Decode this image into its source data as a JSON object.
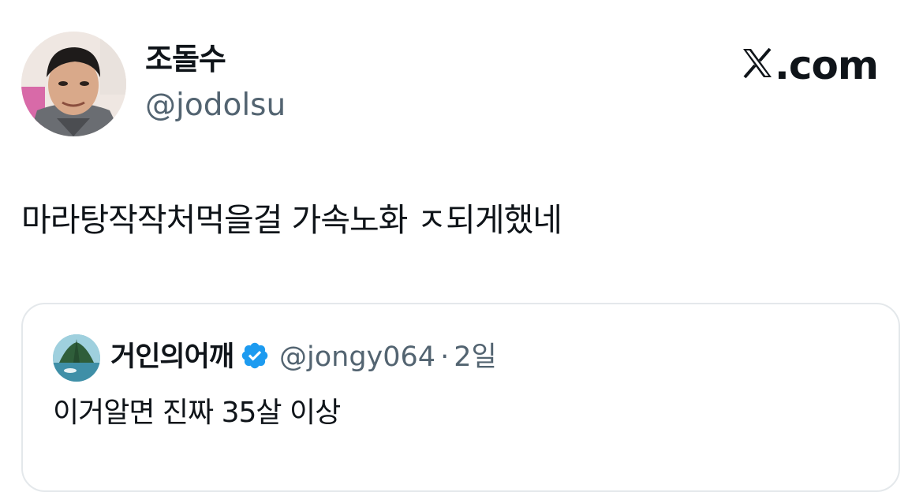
{
  "author": {
    "display_name": "조돌수",
    "handle": "@jodolsu",
    "avatar_icon": "profile-photo"
  },
  "brand": {
    "text": ".com",
    "logo_icon": "x-logo-icon"
  },
  "tweet": {
    "text": "마라탕작작처먹을걸 가속노화 ㅈ되게했네"
  },
  "quoted": {
    "display_name": "거인의어깨",
    "verified_icon": "verified-badge-icon",
    "verified_color": "#1d9bf0",
    "handle": "@jongy064",
    "separator": "·",
    "time": "2일",
    "text": "이거알면 진짜 35살 이상"
  },
  "colors": {
    "text_primary": "#0f1419",
    "text_secondary": "#536471",
    "border": "#e4e8eb"
  }
}
